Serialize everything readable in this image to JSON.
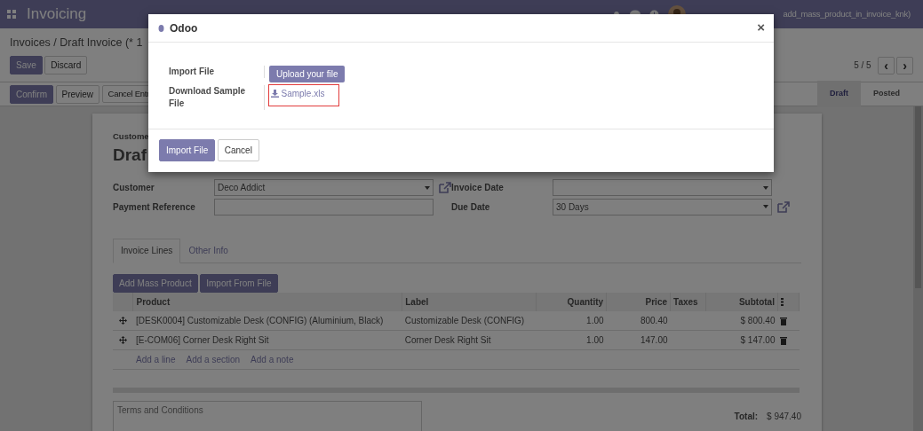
{
  "navbar": {
    "app_title": "Invoicing",
    "user": "add_mass_product_in_invoice_knk)"
  },
  "breadcrumb": "Invoices / Draft Invoice (* 1",
  "edit_buttons": [
    {
      "label": "Save",
      "kind": "primary"
    },
    {
      "label": "Discard",
      "kind": "secondary"
    }
  ],
  "pager": {
    "value": "5 / 5",
    "prev": "‹",
    "next": "›"
  },
  "action_buttons": [
    {
      "label": "Confirm",
      "kind": "primary"
    },
    {
      "label": "Preview",
      "kind": "secondary"
    },
    {
      "label": "Cancel Entr",
      "kind": "secondary"
    }
  ],
  "stages": [
    {
      "label": "Draft",
      "selected": true
    },
    {
      "label": "Posted",
      "selected": false
    }
  ],
  "sheet": {
    "caption": "Custome",
    "title": "Draf",
    "left_fields": [
      {
        "label": "Customer",
        "kind": "select",
        "value": "Deco Addict",
        "link": true
      },
      {
        "label": "Payment Reference",
        "kind": "input",
        "link": false
      }
    ],
    "right_fields": [
      {
        "label": "Invoice Date",
        "kind": "select",
        "link": false
      },
      {
        "label": "Due Date",
        "kind": "select",
        "value": "30 Days",
        "link": true
      }
    ],
    "tabs": [
      {
        "label": "Invoice Lines",
        "selected": true
      },
      {
        "label": "Other Info",
        "selected": false
      }
    ],
    "line_buttons": [
      "Add Mass Product",
      "Import From File"
    ],
    "columns": [
      "Product",
      "Label",
      "Quantity",
      "Price",
      "Taxes",
      "Subtotal"
    ],
    "rows": [
      {
        "product": "[DESK0004] Customizable Desk (CONFIG) (Aluminium, Black)",
        "label": "Customizable Desk (CONFIG)",
        "quantity": "1.00",
        "price": "800.40",
        "subtotal": "$ 800.40"
      },
      {
        "product": "[E-COM06] Corner Desk Right Sit",
        "label": "Corner Desk Right Sit",
        "quantity": "1.00",
        "price": "147.00",
        "subtotal": "$ 147.00"
      }
    ],
    "add_links": [
      "Add a line",
      "Add a section",
      "Add a note"
    ],
    "terms_placeholder": "Terms and Conditions",
    "total_label": "Total:",
    "total_value": "$ 947.40"
  },
  "dialog": {
    "title": "Odoo",
    "close": "×",
    "fields": [
      {
        "label": "Import File",
        "kind": "upload",
        "value": "Upload your file",
        "highlighted": false
      },
      {
        "label": "Download Sample File",
        "kind": "download",
        "value": "Sample.xls",
        "highlighted": true
      }
    ],
    "buttons": [
      {
        "label": "Import File",
        "kind": "primary"
      },
      {
        "label": "Cancel",
        "kind": "secondary"
      }
    ]
  }
}
